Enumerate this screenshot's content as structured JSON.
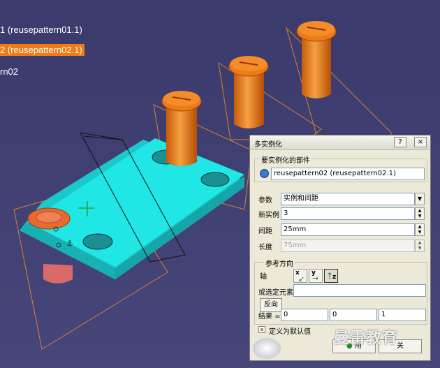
{
  "tree": {
    "items": [
      {
        "label": "1 (reusepattern01.1)",
        "selected": false
      },
      {
        "label": "2 (reusepattern02.1)",
        "selected": true
      },
      {
        "label": "rn02",
        "selected": false
      }
    ]
  },
  "colors": {
    "background": "#3d3d6e",
    "part_body": "#1ee5e5",
    "pins": "#e27416",
    "plane_lines": "#d9822b",
    "selection": "#f07a14"
  },
  "dialog": {
    "title": "多实例化",
    "help_button": "?",
    "close_button": "×",
    "part_group_label": "要实例化的部件",
    "part_value": "reusepattern02 (reusepattern02.1)",
    "params_label": "参数",
    "params_value": "实例和间距",
    "instances_label": "新实例",
    "instances_value": "3",
    "spacing_label": "间距",
    "spacing_value": "25mm",
    "length_label": "长度",
    "length_value": "75mm",
    "ref_group_label": "参考方向",
    "axis_label": "轴",
    "axis_buttons": [
      "x",
      "y",
      "z"
    ],
    "or_select_label": "或选定元素",
    "or_select_value": "",
    "reverse_button": "反向",
    "result_label": "结果 =",
    "result_values": [
      "0",
      "0",
      "1"
    ],
    "default_checkbox_label": "定义为默认值",
    "apply_button": "用",
    "close_bottom_button": "关"
  },
  "watermark": "曼雷教育"
}
